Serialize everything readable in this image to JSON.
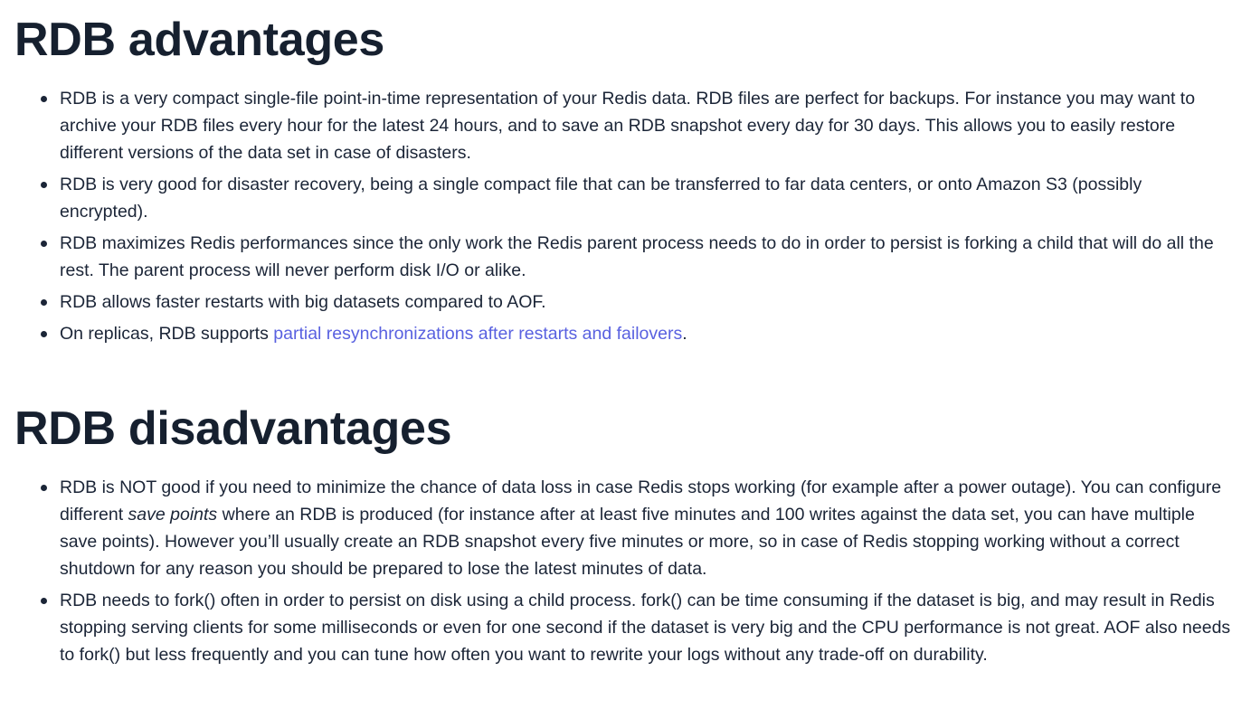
{
  "advantages": {
    "heading": "RDB advantages",
    "items": [
      {
        "text": "RDB is a very compact single-file point-in-time representation of your Redis data. RDB files are perfect for backups. For instance you may want to archive your RDB files every hour for the latest 24 hours, and to save an RDB snapshot every day for 30 days. This allows you to easily restore different versions of the data set in case of disasters."
      },
      {
        "text": "RDB is very good for disaster recovery, being a single compact file that can be transferred to far data centers, or onto Amazon S3 (possibly encrypted)."
      },
      {
        "text": "RDB maximizes Redis performances since the only work the Redis parent process needs to do in order to persist is forking a child that will do all the rest. The parent process will never perform disk I/O or alike."
      },
      {
        "text": "RDB allows faster restarts with big datasets compared to AOF."
      },
      {
        "prefix": "On replicas, RDB supports ",
        "link": "partial resynchronizations after restarts and failovers",
        "suffix": "."
      }
    ]
  },
  "disadvantages": {
    "heading": "RDB disadvantages",
    "items": [
      {
        "before": "RDB is NOT good if you need to minimize the chance of data loss in case Redis stops working (for example after a power outage). You can configure different ",
        "em": "save points",
        "after": " where an RDB is produced (for instance after at least five minutes and 100 writes against the data set, you can have multiple save points). However you’ll usually create an RDB snapshot every five minutes or more, so in case of Redis stopping working without a correct shutdown for any reason you should be prepared to lose the latest minutes of data."
      },
      {
        "text": "RDB needs to fork() often in order to persist on disk using a child process. fork() can be time consuming if the dataset is big, and may result in Redis stopping serving clients for some milliseconds or even for one second if the dataset is very big and the CPU performance is not great. AOF also needs to fork() but less frequently and you can tune how often you want to rewrite your logs without any trade-off on durability."
      }
    ]
  },
  "colors": {
    "text": "#1b2537",
    "heading": "#16202f",
    "link": "#5961e0",
    "background": "#ffffff"
  }
}
